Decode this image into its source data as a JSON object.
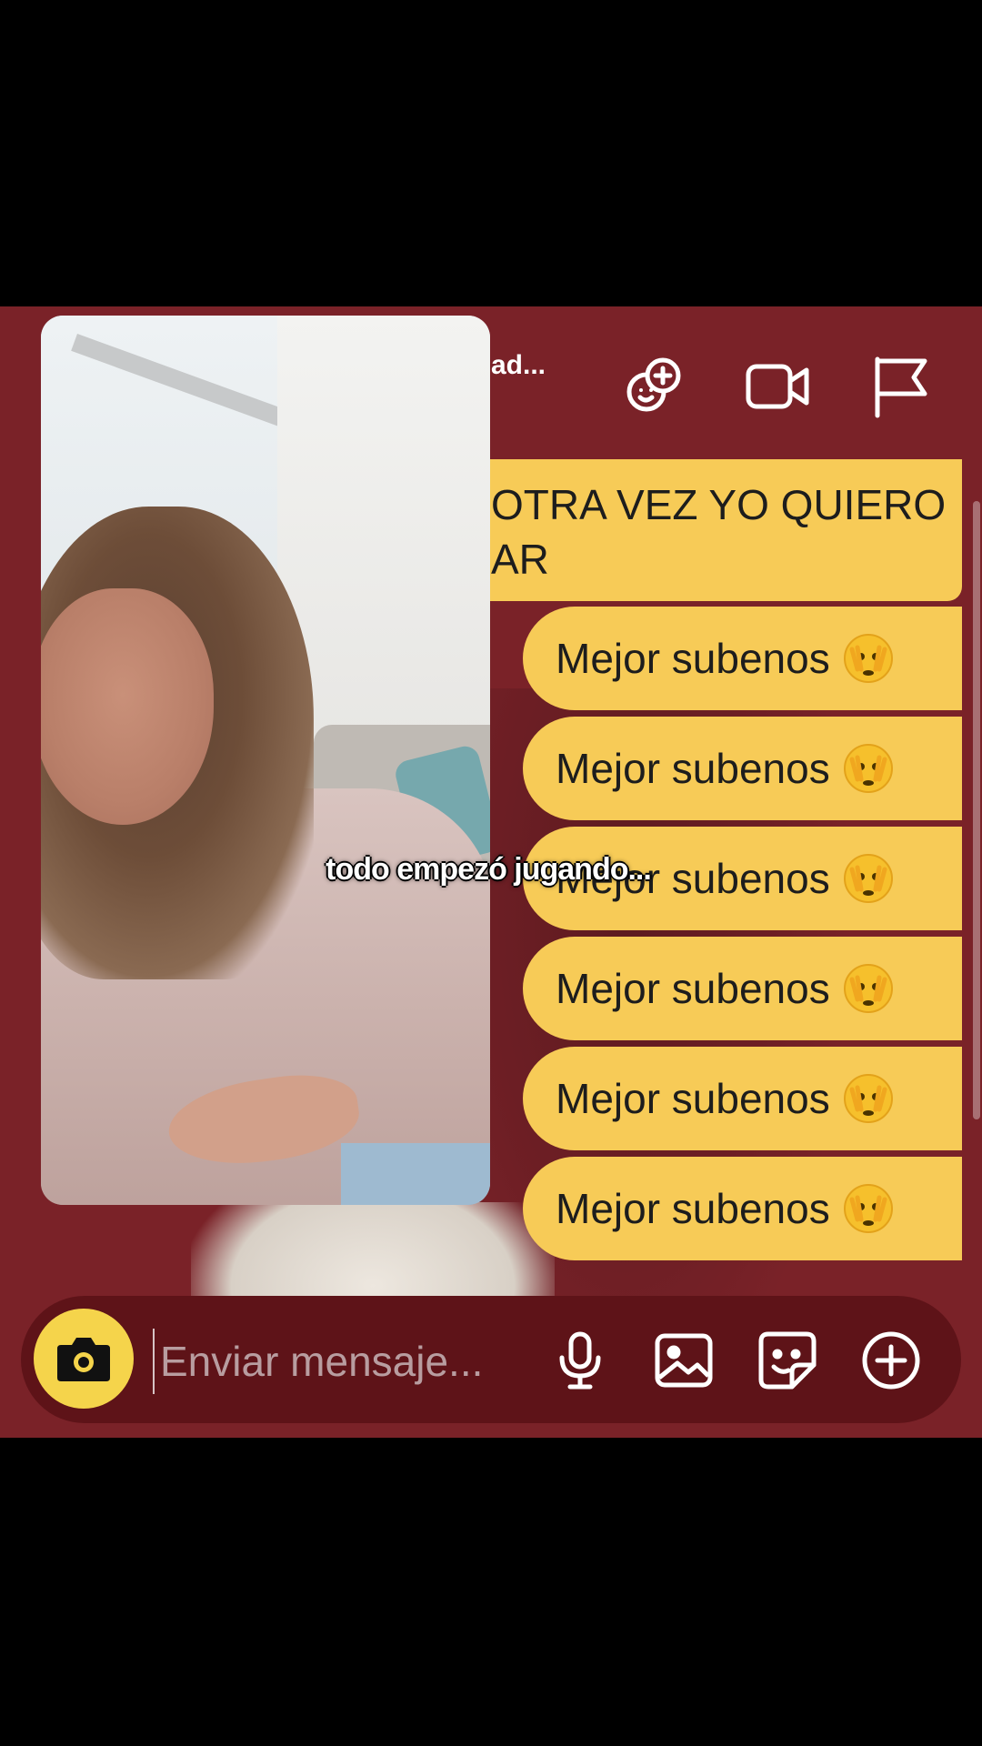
{
  "header": {
    "title": "ad...",
    "icons": [
      "add-friend-bitmoji-icon",
      "video-call-icon",
      "report-flag-icon"
    ]
  },
  "messages": {
    "top": {
      "line1": "OTRA VEZ YO QUIERO",
      "line2": "AR"
    },
    "items": [
      {
        "text": "Mejor subenos",
        "emoji": "peeking-face-emoji"
      },
      {
        "text": "Mejor subenos",
        "emoji": "peeking-face-emoji"
      },
      {
        "text": "Mejor subenos",
        "emoji": "peeking-face-emoji"
      },
      {
        "text": "Mejor subenos",
        "emoji": "peeking-face-emoji"
      },
      {
        "text": "Mejor subenos",
        "emoji": "peeking-face-emoji"
      },
      {
        "text": "Mejor subenos",
        "emoji": "peeking-face-emoji"
      }
    ]
  },
  "overlay": {
    "caption": "todo empezó jugando..."
  },
  "composer": {
    "placeholder": "Enviar mensaje...",
    "icons": [
      "camera-icon",
      "microphone-icon",
      "image-icon",
      "sticker-icon",
      "plus-icon"
    ]
  },
  "colors": {
    "background": "#7a2228",
    "bubble": "#f7cb57",
    "composer": "#5e1318",
    "camera_button": "#f5d44b"
  }
}
